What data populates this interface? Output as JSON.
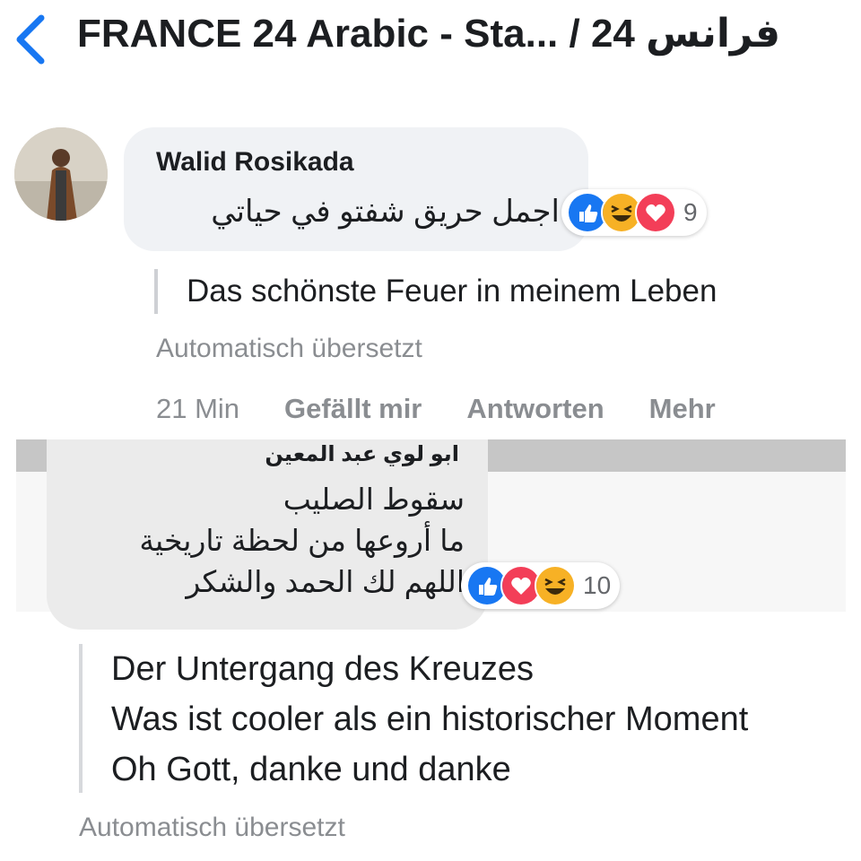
{
  "header": {
    "title": "FRANCE 24 Arabic - Sta... / فرانس 24",
    "back_icon": "chevron-left-icon",
    "accent": "#1877f2"
  },
  "comment1": {
    "author": "Walid Rosikada",
    "text": "اجمل حريق شفتو في حياتي",
    "reactions": [
      "like-icon",
      "haha-icon",
      "love-icon"
    ],
    "reaction_count": "9",
    "translation": "Das schönste Feuer in meinem Leben",
    "auto_label": "Automatisch übersetzt",
    "time": "21 Min",
    "actions": [
      "Gefällt mir",
      "Antworten",
      "Mehr"
    ]
  },
  "comment2": {
    "author": "ابو لوي عبد المعين",
    "lines": [
      "سقوط الصليب",
      "ما أروعها من لحظة تاريخية",
      "اللهم لك الحمد والشكر"
    ],
    "reactions": [
      "like-icon",
      "love-icon",
      "haha-icon"
    ],
    "reaction_count": "10",
    "translation_lines": [
      "Der Untergang des Kreuzes",
      "Was ist cooler als ein historischer Moment",
      "Oh Gott, danke und danke"
    ],
    "auto_label": "Automatisch übersetzt"
  },
  "colors": {
    "like": "#1877f2",
    "love": "#f33e58",
    "haha": "#f7b125",
    "bubble": "#f0f2f5",
    "muted": "#8a8d91"
  }
}
